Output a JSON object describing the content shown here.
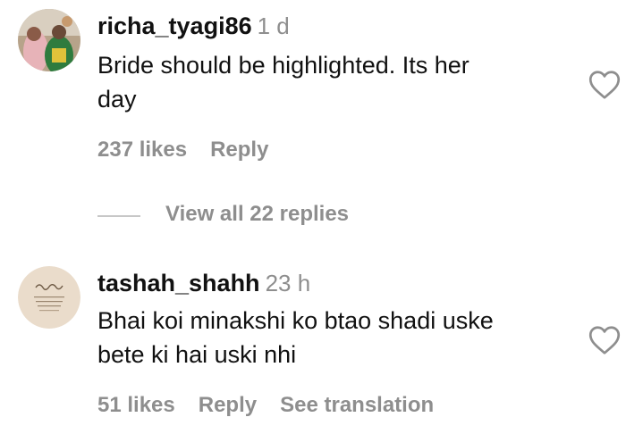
{
  "comments": [
    {
      "username": "richa_tyagi86",
      "time": "1 d",
      "text_line1": "Bride should be highlighted. Its her",
      "text_line2": "day",
      "likes": "237 likes",
      "reply": "Reply"
    },
    {
      "username": "tashah_shahh",
      "time": "23 h",
      "text_line1": "Bhai koi minakshi ko btao shadi uske",
      "text_line2": "bete ki hai uski nhi",
      "likes": "51 likes",
      "reply": "Reply",
      "see_translation": "See translation"
    }
  ],
  "view_replies": "View all 22 replies",
  "icons": {
    "like": "heart-outline-icon",
    "avatar1": "profile-photo",
    "avatar2": "profile-photo-calligraphy"
  },
  "colors": {
    "text": "#111111",
    "secondary": "#8e8e8e",
    "divider": "#c7c7c7"
  }
}
